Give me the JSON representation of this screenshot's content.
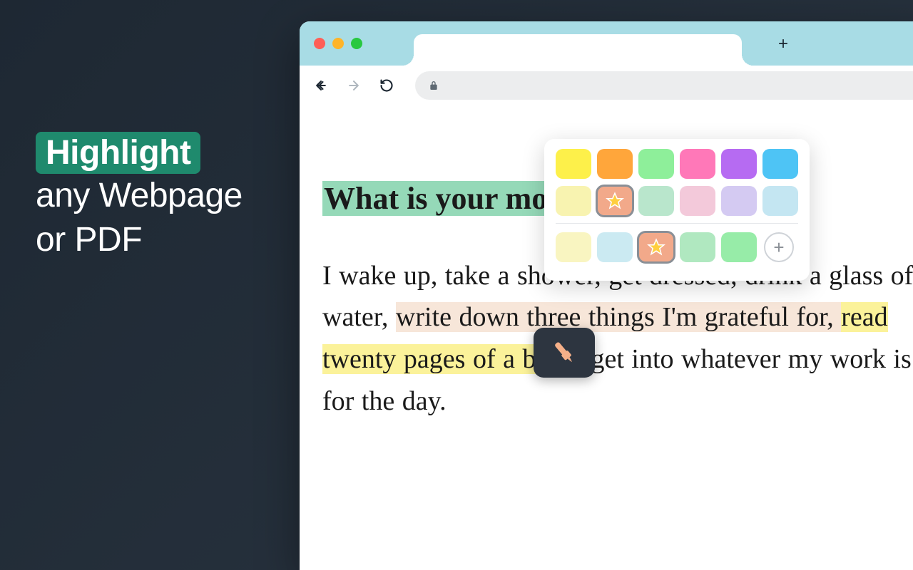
{
  "promo": {
    "highlight": "Highlight",
    "line1": "any Webpage",
    "line2": "or PDF"
  },
  "browser": {
    "new_tab_label": "+"
  },
  "page": {
    "heading": "What is your morning routine?",
    "body_plain1": "I wake up, take a shower, get dressed, drink a glass of water, ",
    "body_hl1": "write down three things I'm grateful for, ",
    "body_hl2": "read twenty pages of a book",
    "body_plain2": ", get into whatever my work is for the day."
  },
  "picker": {
    "row1": [
      {
        "name": "yellow",
        "color": "#fdf04a"
      },
      {
        "name": "orange",
        "color": "#ffa63b"
      },
      {
        "name": "green",
        "color": "#8eef9a"
      },
      {
        "name": "pink",
        "color": "#ff78b8"
      },
      {
        "name": "purple",
        "color": "#b66bf2"
      },
      {
        "name": "blue",
        "color": "#4ec4f5"
      }
    ],
    "row2": [
      {
        "name": "pastel-yellow",
        "color": "#f8f3b0"
      },
      {
        "name": "star-peach",
        "color": "#f2a98a",
        "star": true,
        "selected": true
      },
      {
        "name": "pastel-green",
        "color": "#b9e6cc"
      },
      {
        "name": "pastel-pink",
        "color": "#f3c9da"
      },
      {
        "name": "pastel-purple",
        "color": "#d4caf2"
      },
      {
        "name": "pastel-blue",
        "color": "#c4e6f2"
      }
    ],
    "row3": [
      {
        "name": "light-yellow",
        "color": "#f9f5c1"
      },
      {
        "name": "light-blue",
        "color": "#cbeaf2"
      },
      {
        "name": "star-peach-2",
        "color": "#f2a98a",
        "star": true,
        "selected": true
      },
      {
        "name": "light-green1",
        "color": "#b0e8c0"
      },
      {
        "name": "light-green2",
        "color": "#97eca8"
      }
    ],
    "add_label": "+"
  }
}
